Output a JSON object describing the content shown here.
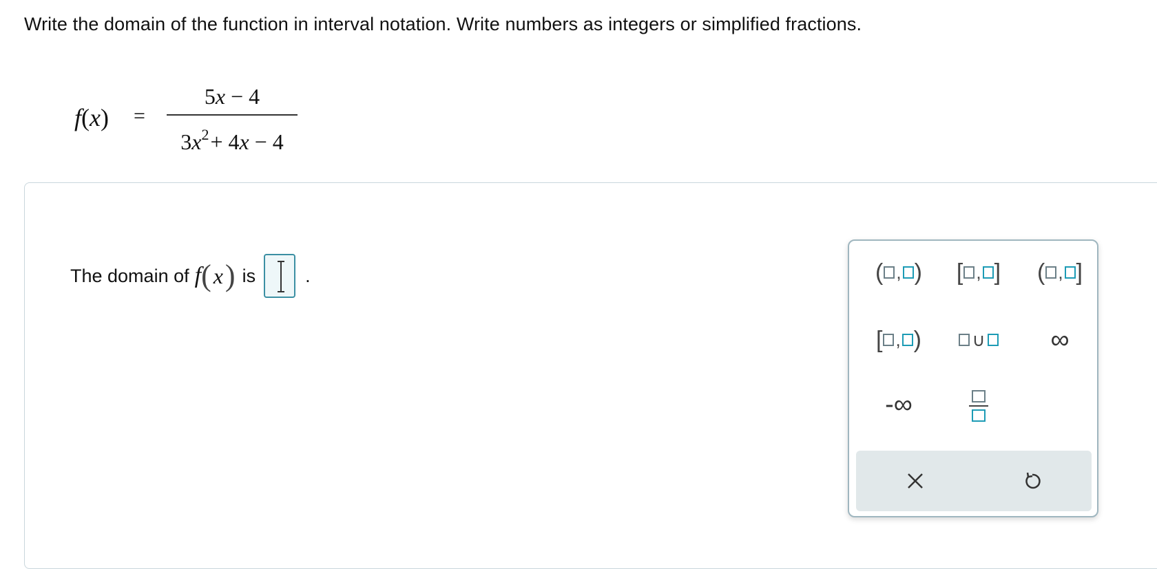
{
  "instruction": "Write the domain of the function in interval notation. Write numbers as integers or simplified fractions.",
  "function": {
    "lhs_name": "f",
    "lhs_var": "x",
    "equals": "=",
    "numerator": "5x − 4",
    "numerator_parts": [
      "5",
      "x",
      " − 4"
    ],
    "denominator_parts": [
      "3",
      "x",
      "2",
      " + 4",
      "x",
      " − 4"
    ]
  },
  "answer": {
    "prefix": "The domain of",
    "func_name": "f",
    "func_var": "x",
    "suffix": "is",
    "value": "",
    "period": "."
  },
  "palette": {
    "buttons": [
      {
        "name": "open-interval",
        "left": "(",
        "right": ")"
      },
      {
        "name": "closed-interval",
        "left": "[",
        "right": "]"
      },
      {
        "name": "open-closed-interval",
        "left": "(",
        "right": "]"
      },
      {
        "name": "closed-open-interval",
        "left": "[",
        "right": ")"
      },
      {
        "name": "union",
        "symbol": "∪"
      },
      {
        "name": "infinity",
        "symbol": "∞"
      },
      {
        "name": "negative-infinity",
        "symbol": "-∞"
      },
      {
        "name": "fraction"
      }
    ],
    "clear_icon": "x-icon",
    "undo_icon": "undo-icon"
  }
}
